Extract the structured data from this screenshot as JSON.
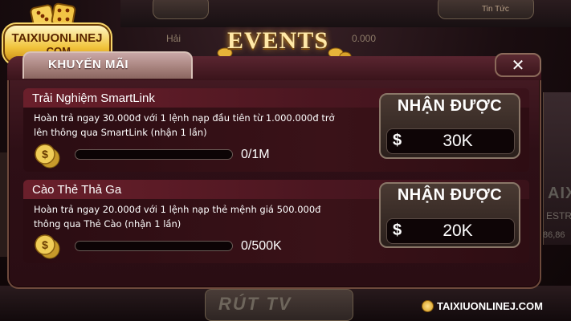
{
  "background": {
    "news_label": "Tin Tức",
    "cash_left": "Hải",
    "cash_right": "0.000",
    "right_panel_text1": "AIX",
    "right_panel_text2": "ESTR",
    "right_panel_text3": "86,86",
    "bottom_button_label": "RÚT TV"
  },
  "logo": {
    "main": "TAIXIUONLINEJ",
    "sub": ".COM"
  },
  "events_title": "EVENTS",
  "modal": {
    "tab_label": "KHUYẾN MÃI",
    "close_label": "✕"
  },
  "events": [
    {
      "title": "Trải Nghiệm SmartLink",
      "desc_line1": "Hoàn trả ngay 30.000đ với 1 lệnh nạp đầu tiên từ 1.000.000đ trở",
      "desc_line2": "lên thông qua SmartLink (nhận 1 lần)",
      "progress_text": "0/1M",
      "progress_fraction": 0,
      "reward_label": "NHẬN ĐƯỢC",
      "reward_currency": "$",
      "reward_amount": "30K"
    },
    {
      "title": "Cào Thẻ Thả Ga",
      "desc_line1": "Hoàn trả ngay 20.000đ với 1 lệnh nạp thẻ mệnh giá 500.000đ",
      "desc_line2": "thông qua Thẻ Cào (nhận 1 lần)",
      "progress_text": "0/500K",
      "progress_fraction": 0,
      "reward_label": "NHẬN ĐƯỢC",
      "reward_currency": "$",
      "reward_amount": "20K"
    }
  ],
  "watermark": "TAIXIUONLINEJ.COM",
  "colors": {
    "accent_gold": "#f0c23a",
    "modal_bg": "#2e0f16",
    "row_header": "#6a1f2b"
  }
}
